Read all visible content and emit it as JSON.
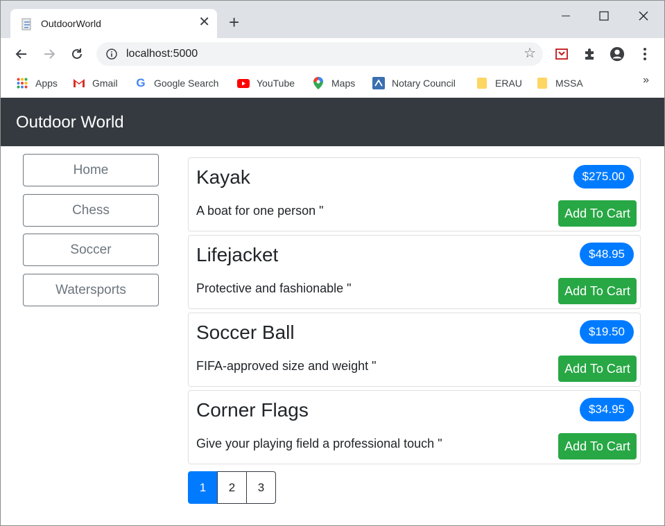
{
  "browser": {
    "tab_title": "OutdoorWorld",
    "url": "localhost:5000",
    "bookmarks": [
      {
        "label": "Apps",
        "icon": "apps-grid-icon"
      },
      {
        "label": "Gmail",
        "icon": "gmail-icon"
      },
      {
        "label": "Google Search",
        "icon": "google-icon"
      },
      {
        "label": "YouTube",
        "icon": "youtube-icon"
      },
      {
        "label": "Maps",
        "icon": "maps-pin-icon"
      },
      {
        "label": "Notary Council",
        "icon": "notary-icon"
      },
      {
        "label": "ERAU",
        "icon": "folder-icon"
      },
      {
        "label": "MSSA",
        "icon": "folder-icon"
      }
    ],
    "bookmarks_more": "»"
  },
  "site": {
    "brand": "Outdoor World"
  },
  "categories": [
    "Home",
    "Chess",
    "Soccer",
    "Watersports"
  ],
  "products": [
    {
      "name": "Kayak",
      "price": "$275.00",
      "description": "A boat for one person  \"",
      "cart_label": "Add To Cart"
    },
    {
      "name": "Lifejacket",
      "price": "$48.95",
      "description": "Protective and fashionable  \"",
      "cart_label": "Add To Cart"
    },
    {
      "name": "Soccer Ball",
      "price": "$19.50",
      "description": "FIFA-approved size and weight  \"",
      "cart_label": "Add To Cart"
    },
    {
      "name": "Corner Flags",
      "price": "$34.95",
      "description": "Give your playing field a professional touch  \"",
      "cart_label": "Add To Cart"
    }
  ],
  "pagination": {
    "pages": [
      "1",
      "2",
      "3"
    ],
    "current": "1"
  },
  "colors": {
    "navbar": "#343a40",
    "primary": "#007bff",
    "success": "#28a745",
    "secondary": "#6c757d"
  }
}
